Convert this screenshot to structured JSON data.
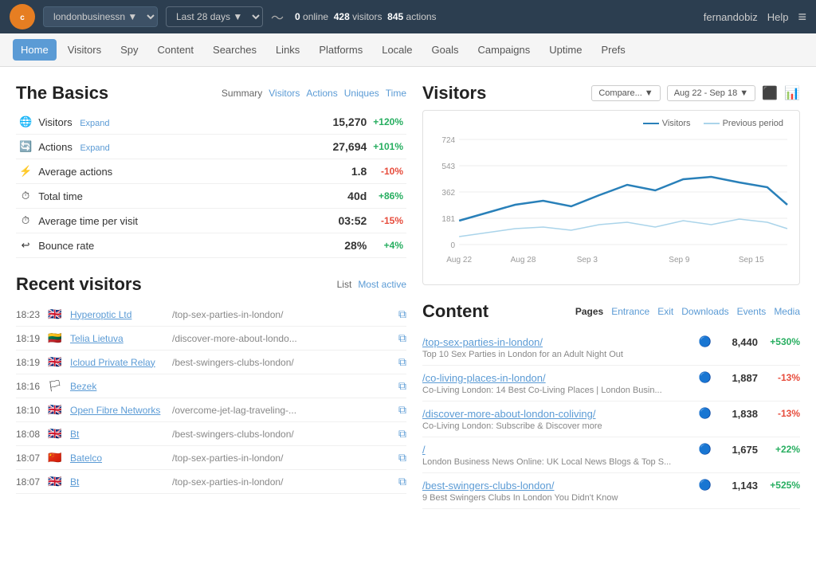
{
  "topnav": {
    "logo": "C",
    "site_label": "londonbusinessn ▼",
    "date_label": "Last 28 days ▼",
    "chart_icon": "〜",
    "stats": {
      "online_label": "online",
      "online_val": "0",
      "visitors_label": "visitors",
      "visitors_val": "428",
      "actions_label": "actions",
      "actions_val": "845"
    },
    "user": "fernandobiz",
    "help": "Help",
    "menu_icon": "≡"
  },
  "subnav": {
    "items": [
      {
        "label": "Home",
        "active": true
      },
      {
        "label": "Visitors",
        "active": false
      },
      {
        "label": "Spy",
        "active": false
      },
      {
        "label": "Content",
        "active": false
      },
      {
        "label": "Searches",
        "active": false
      },
      {
        "label": "Links",
        "active": false
      },
      {
        "label": "Platforms",
        "active": false
      },
      {
        "label": "Locale",
        "active": false
      },
      {
        "label": "Goals",
        "active": false
      },
      {
        "label": "Campaigns",
        "active": false
      },
      {
        "label": "Uptime",
        "active": false
      },
      {
        "label": "Prefs",
        "active": false
      }
    ]
  },
  "basics": {
    "title": "The Basics",
    "tabs": [
      {
        "label": "Summary",
        "active": true
      },
      {
        "label": "Visitors",
        "active": false
      },
      {
        "label": "Actions",
        "active": false
      },
      {
        "label": "Uniques",
        "active": false
      },
      {
        "label": "Time",
        "active": false
      }
    ],
    "metrics": [
      {
        "icon": "🌐",
        "name": "Visitors",
        "expand": true,
        "value": "15,270",
        "change": "+120%",
        "positive": true
      },
      {
        "icon": "🔄",
        "name": "Actions",
        "expand": true,
        "value": "27,694",
        "change": "+101%",
        "positive": true
      },
      {
        "icon": "⚡",
        "name": "Average actions",
        "expand": false,
        "value": "1.8",
        "change": "-10%",
        "positive": false
      },
      {
        "icon": "⏱",
        "name": "Total time",
        "expand": false,
        "value": "40d",
        "change": "+86%",
        "positive": true
      },
      {
        "icon": "⏱",
        "name": "Average time per visit",
        "expand": false,
        "value": "03:52",
        "change": "-15%",
        "positive": false
      },
      {
        "icon": "↩",
        "name": "Bounce rate",
        "expand": false,
        "value": "28%",
        "change": "+4%",
        "positive": true
      }
    ]
  },
  "recent": {
    "title": "Recent visitors",
    "tabs": [
      {
        "label": "List",
        "active": false
      },
      {
        "label": "Most active",
        "active": true
      }
    ],
    "visitors": [
      {
        "time": "18:23",
        "flag": "🇬🇧",
        "isp": "Hyperoptic Ltd",
        "url": "/top-sex-parties-in-london/"
      },
      {
        "time": "18:19",
        "flag": "🇱🇹",
        "isp": "Telia Lietuva",
        "url": "/discover-more-about-londo..."
      },
      {
        "time": "18:19",
        "flag": "🇬🇧",
        "isp": "Icloud Private Relay",
        "url": "/best-swingers-clubs-london/"
      },
      {
        "time": "18:16",
        "flag": "🏳",
        "isp": "Bezek",
        "url": ""
      },
      {
        "time": "18:10",
        "flag": "🇬🇧",
        "isp": "Open Fibre Networks",
        "url": "/overcome-jet-lag-traveling-..."
      },
      {
        "time": "18:08",
        "flag": "🇬🇧",
        "isp": "Bt",
        "url": "/best-swingers-clubs-london/"
      },
      {
        "time": "18:07",
        "flag": "🇨🇳",
        "isp": "Batelco",
        "url": "/top-sex-parties-in-london/"
      },
      {
        "time": "18:07",
        "flag": "🇬🇧",
        "isp": "Bt",
        "url": "/top-sex-parties-in-london/"
      }
    ]
  },
  "visitors_chart": {
    "title": "Visitors",
    "compare_label": "Compare... ▼",
    "date_range": "Aug 22 - Sep 18 ▼",
    "legend": {
      "visitors": "Visitors",
      "previous": "Previous period"
    },
    "y_labels": [
      "724",
      "543",
      "362",
      "181",
      "0"
    ],
    "x_labels": [
      "Aug 22",
      "Aug 28",
      "Sep 3",
      "Sep 9",
      "Sep 15"
    ]
  },
  "content": {
    "title": "Content",
    "tabs": [
      {
        "label": "Pages",
        "active": true
      },
      {
        "label": "Entrance",
        "active": false
      },
      {
        "label": "Exit",
        "active": false
      },
      {
        "label": "Downloads",
        "active": false
      },
      {
        "label": "Events",
        "active": false
      },
      {
        "label": "Media",
        "active": false
      }
    ],
    "items": [
      {
        "url": "/top-sex-parties-in-london/",
        "desc": "Top 10 Sex Parties in London for an Adult Night Out",
        "count": "8,440",
        "change": "+530%",
        "positive": true
      },
      {
        "url": "/co-living-places-in-london/",
        "desc": "Co-Living London: 14 Best Co-Living Places | London Busin...",
        "count": "1,887",
        "change": "-13%",
        "positive": false
      },
      {
        "url": "/discover-more-about-london-coliving/",
        "desc": "Co-Living London: Subscribe & Discover more",
        "count": "1,838",
        "change": "-13%",
        "positive": false
      },
      {
        "url": "/",
        "desc": "London Business News Online: UK Local News Blogs & Top S...",
        "count": "1,675",
        "change": "+22%",
        "positive": true
      },
      {
        "url": "/best-swingers-clubs-london/",
        "desc": "9 Best Swingers Clubs In London You Didn't Know",
        "count": "1,143",
        "change": "+525%",
        "positive": true
      }
    ]
  }
}
